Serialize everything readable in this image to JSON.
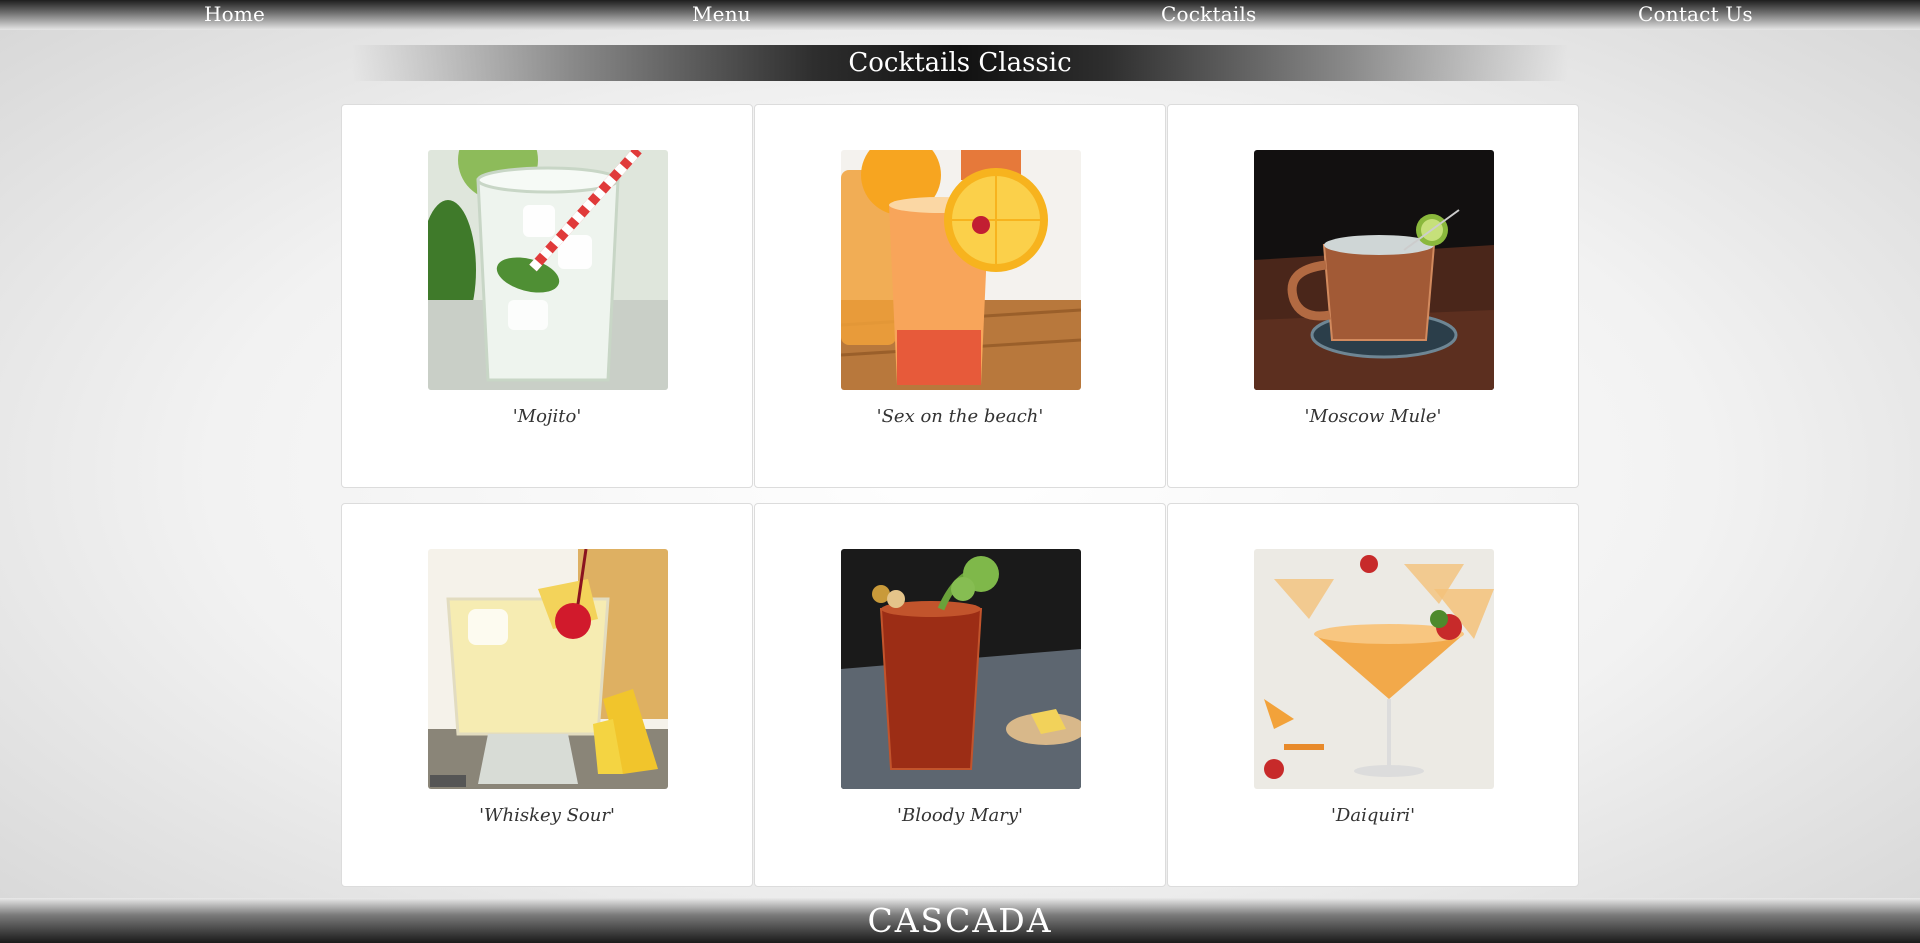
{
  "nav": {
    "items": [
      {
        "label": "Home"
      },
      {
        "label": "Menu"
      },
      {
        "label": "Cocktails"
      },
      {
        "label": "Contact Us"
      }
    ]
  },
  "page": {
    "title": "Cocktails Classic"
  },
  "cocktails": [
    {
      "name": "'Mojito'",
      "image": "mojito-photo"
    },
    {
      "name": "'Sex on the beach'",
      "image": "sex-on-the-beach-photo"
    },
    {
      "name": "'Moscow Mule'",
      "image": "moscow-mule-photo"
    },
    {
      "name": "'Whiskey Sour'",
      "image": "whiskey-sour-photo"
    },
    {
      "name": "'Bloody Mary'",
      "image": "bloody-mary-photo"
    },
    {
      "name": "'Daiquiri'",
      "image": "daiquiri-photo"
    }
  ],
  "footer": {
    "brand": "CASCADA"
  },
  "colors": {
    "nav_dark": "#1e1e1e",
    "card_bg": "#ffffff",
    "text": "#333333"
  }
}
